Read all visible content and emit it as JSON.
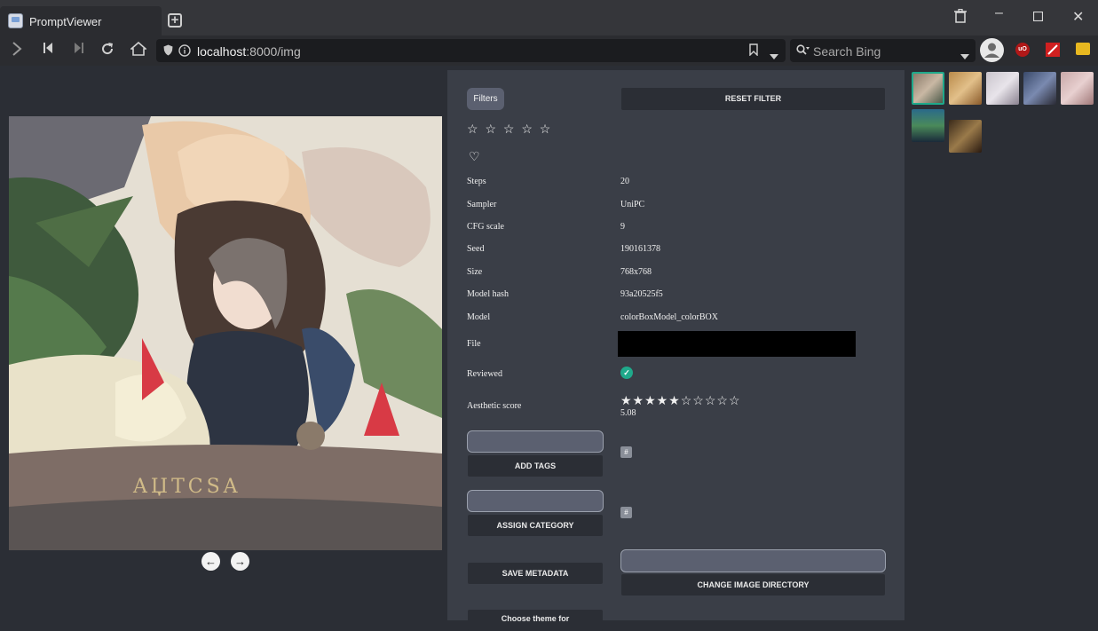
{
  "browser": {
    "tab_title": "PromptViewer",
    "url_host": "localhost",
    "url_rest": ":8000/img",
    "search_placeholder": "Search Bing"
  },
  "panel": {
    "filters_label": "Filters",
    "reset_filter_label": "RESET FILTER",
    "filter_stars": "☆ ☆ ☆ ☆ ☆",
    "favorite_icon": "♡",
    "fields": [
      {
        "label": "Steps",
        "value": "20"
      },
      {
        "label": "Sampler",
        "value": "UniPC"
      },
      {
        "label": "CFG scale",
        "value": "9"
      },
      {
        "label": "Seed",
        "value": "190161378"
      },
      {
        "label": "Size",
        "value": "768x768"
      },
      {
        "label": "Model hash",
        "value": "93a20525f5"
      },
      {
        "label": "Model",
        "value": "colorBoxModel_colorBOX"
      }
    ],
    "file_label": "File",
    "reviewed_label": "Reviewed",
    "reviewed_icon": "✓",
    "aesthetic_label": "Aesthetic score",
    "aesthetic_stars": "★★★★★☆☆☆☆☆",
    "aesthetic_score": "5.08",
    "aesthetic_rating_fraction": 0.5,
    "add_tags_label": "ADD TAGS",
    "assign_category_label": "ASSIGN CATEGORY",
    "save_metadata_label": "SAVE METADATA",
    "change_dir_label": "CHANGE IMAGE DIRECTORY",
    "choose_theme_label": "Choose theme for",
    "hash_badge": "#"
  },
  "nav": {
    "prev_icon": "←",
    "next_icon": "→"
  },
  "image_watermark_text": "AЏTCSA",
  "colors": {
    "page_bg": "#2b2e35",
    "panel_bg": "#3a3e47",
    "button_bg": "#2b2e35",
    "input_bg": "#5b6070",
    "check_green": "#1fa98b"
  }
}
